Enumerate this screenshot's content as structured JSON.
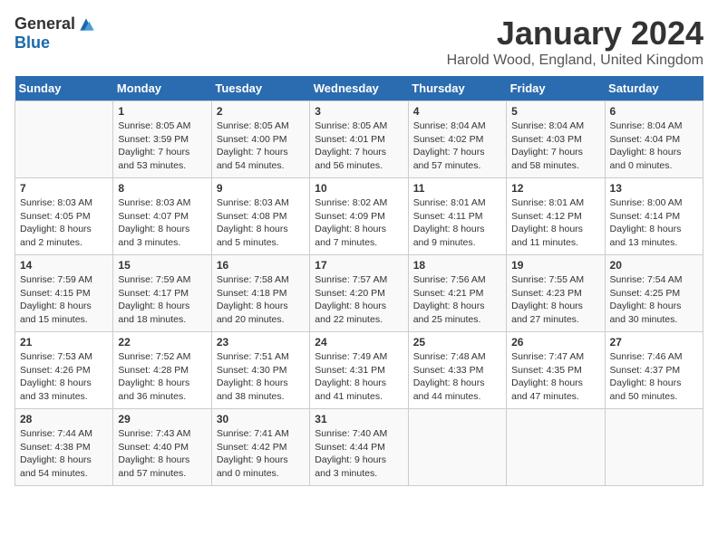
{
  "logo": {
    "general": "General",
    "blue": "Blue"
  },
  "title": "January 2024",
  "location": "Harold Wood, England, United Kingdom",
  "days_of_week": [
    "Sunday",
    "Monday",
    "Tuesday",
    "Wednesday",
    "Thursday",
    "Friday",
    "Saturday"
  ],
  "weeks": [
    [
      {
        "day": "",
        "info": ""
      },
      {
        "day": "1",
        "info": "Sunrise: 8:05 AM\nSunset: 3:59 PM\nDaylight: 7 hours\nand 53 minutes."
      },
      {
        "day": "2",
        "info": "Sunrise: 8:05 AM\nSunset: 4:00 PM\nDaylight: 7 hours\nand 54 minutes."
      },
      {
        "day": "3",
        "info": "Sunrise: 8:05 AM\nSunset: 4:01 PM\nDaylight: 7 hours\nand 56 minutes."
      },
      {
        "day": "4",
        "info": "Sunrise: 8:04 AM\nSunset: 4:02 PM\nDaylight: 7 hours\nand 57 minutes."
      },
      {
        "day": "5",
        "info": "Sunrise: 8:04 AM\nSunset: 4:03 PM\nDaylight: 7 hours\nand 58 minutes."
      },
      {
        "day": "6",
        "info": "Sunrise: 8:04 AM\nSunset: 4:04 PM\nDaylight: 8 hours\nand 0 minutes."
      }
    ],
    [
      {
        "day": "7",
        "info": "Sunrise: 8:03 AM\nSunset: 4:05 PM\nDaylight: 8 hours\nand 2 minutes."
      },
      {
        "day": "8",
        "info": "Sunrise: 8:03 AM\nSunset: 4:07 PM\nDaylight: 8 hours\nand 3 minutes."
      },
      {
        "day": "9",
        "info": "Sunrise: 8:03 AM\nSunset: 4:08 PM\nDaylight: 8 hours\nand 5 minutes."
      },
      {
        "day": "10",
        "info": "Sunrise: 8:02 AM\nSunset: 4:09 PM\nDaylight: 8 hours\nand 7 minutes."
      },
      {
        "day": "11",
        "info": "Sunrise: 8:01 AM\nSunset: 4:11 PM\nDaylight: 8 hours\nand 9 minutes."
      },
      {
        "day": "12",
        "info": "Sunrise: 8:01 AM\nSunset: 4:12 PM\nDaylight: 8 hours\nand 11 minutes."
      },
      {
        "day": "13",
        "info": "Sunrise: 8:00 AM\nSunset: 4:14 PM\nDaylight: 8 hours\nand 13 minutes."
      }
    ],
    [
      {
        "day": "14",
        "info": "Sunrise: 7:59 AM\nSunset: 4:15 PM\nDaylight: 8 hours\nand 15 minutes."
      },
      {
        "day": "15",
        "info": "Sunrise: 7:59 AM\nSunset: 4:17 PM\nDaylight: 8 hours\nand 18 minutes."
      },
      {
        "day": "16",
        "info": "Sunrise: 7:58 AM\nSunset: 4:18 PM\nDaylight: 8 hours\nand 20 minutes."
      },
      {
        "day": "17",
        "info": "Sunrise: 7:57 AM\nSunset: 4:20 PM\nDaylight: 8 hours\nand 22 minutes."
      },
      {
        "day": "18",
        "info": "Sunrise: 7:56 AM\nSunset: 4:21 PM\nDaylight: 8 hours\nand 25 minutes."
      },
      {
        "day": "19",
        "info": "Sunrise: 7:55 AM\nSunset: 4:23 PM\nDaylight: 8 hours\nand 27 minutes."
      },
      {
        "day": "20",
        "info": "Sunrise: 7:54 AM\nSunset: 4:25 PM\nDaylight: 8 hours\nand 30 minutes."
      }
    ],
    [
      {
        "day": "21",
        "info": "Sunrise: 7:53 AM\nSunset: 4:26 PM\nDaylight: 8 hours\nand 33 minutes."
      },
      {
        "day": "22",
        "info": "Sunrise: 7:52 AM\nSunset: 4:28 PM\nDaylight: 8 hours\nand 36 minutes."
      },
      {
        "day": "23",
        "info": "Sunrise: 7:51 AM\nSunset: 4:30 PM\nDaylight: 8 hours\nand 38 minutes."
      },
      {
        "day": "24",
        "info": "Sunrise: 7:49 AM\nSunset: 4:31 PM\nDaylight: 8 hours\nand 41 minutes."
      },
      {
        "day": "25",
        "info": "Sunrise: 7:48 AM\nSunset: 4:33 PM\nDaylight: 8 hours\nand 44 minutes."
      },
      {
        "day": "26",
        "info": "Sunrise: 7:47 AM\nSunset: 4:35 PM\nDaylight: 8 hours\nand 47 minutes."
      },
      {
        "day": "27",
        "info": "Sunrise: 7:46 AM\nSunset: 4:37 PM\nDaylight: 8 hours\nand 50 minutes."
      }
    ],
    [
      {
        "day": "28",
        "info": "Sunrise: 7:44 AM\nSunset: 4:38 PM\nDaylight: 8 hours\nand 54 minutes."
      },
      {
        "day": "29",
        "info": "Sunrise: 7:43 AM\nSunset: 4:40 PM\nDaylight: 8 hours\nand 57 minutes."
      },
      {
        "day": "30",
        "info": "Sunrise: 7:41 AM\nSunset: 4:42 PM\nDaylight: 9 hours\nand 0 minutes."
      },
      {
        "day": "31",
        "info": "Sunrise: 7:40 AM\nSunset: 4:44 PM\nDaylight: 9 hours\nand 3 minutes."
      },
      {
        "day": "",
        "info": ""
      },
      {
        "day": "",
        "info": ""
      },
      {
        "day": "",
        "info": ""
      }
    ]
  ]
}
